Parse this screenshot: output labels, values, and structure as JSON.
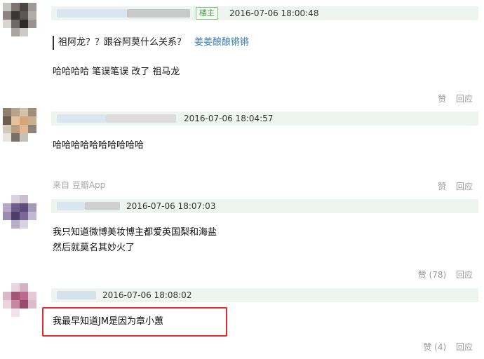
{
  "comments": [
    {
      "is_op": true,
      "op_badge": "楼主",
      "timestamp": "2016-07-06 18:00:48",
      "quote": {
        "text": "祖阿龙？？跟谷阿莫什么关系？",
        "author": "姜姜酿酿锵锵"
      },
      "body": [
        "哈哈哈哈 笔误笔误 改了 祖马龙"
      ],
      "source": "",
      "like_label": "赞",
      "reply_label": "回应"
    },
    {
      "is_op": false,
      "timestamp": "2016-07-06 18:04:57",
      "body": [
        "哈哈哈哈哈哈哈哈哈哈"
      ],
      "source": "来自 豆瓣App",
      "like_label": "赞",
      "reply_label": "回应"
    },
    {
      "is_op": false,
      "timestamp": "2016-07-06 18:07:03",
      "body": [
        "我只知道微博美妆博主都爱英国梨和海盐",
        "然后就莫名其妙火了"
      ],
      "source": "",
      "like_label": "赞 (78)",
      "reply_label": "回应"
    },
    {
      "is_op": false,
      "timestamp": "2016-07-06 18:08:02",
      "body": [
        "我最早知道JM是因为章小蕙"
      ],
      "source": "",
      "like_label": "赞 (4)",
      "reply_label": "回应",
      "highlighted": true
    }
  ],
  "colors": {
    "header_bg": "#eef4ef",
    "link": "#3f7fb5",
    "op_badge": "#3e9b3e",
    "highlight": "#e32b2b",
    "muted": "#9a9a9a"
  }
}
